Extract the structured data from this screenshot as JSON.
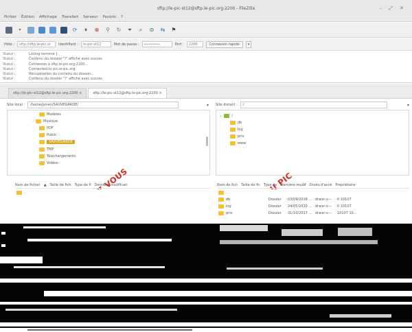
{
  "window": {
    "title": "sftp://le-pic-st12@sftp.le-pic.org:2200 - FileZilla",
    "controls": "– ⤢ ✕"
  },
  "menu": [
    "Fichier",
    "Édition",
    "Affichage",
    "Transfert",
    "Serveur",
    "Favoris",
    "?"
  ],
  "toolbar": {
    "icons": [
      "site-manager-icon",
      "dropdown-icon",
      "toggle-log-icon",
      "toggle-tree-icon",
      "toggle-remote-tree-icon",
      "toggle-queue-icon",
      "refresh-icon",
      "process-queue-icon",
      "cancel-icon",
      "disconnect-icon",
      "reconnect-icon",
      "filter-icon",
      "search-icon",
      "compare-icon",
      "sync-icon",
      "find-icon"
    ]
  },
  "quickconnect": {
    "host_label": "Hôte :",
    "host_value": "sftp://sftp.le-pic.or",
    "user_label": "Identifiant :",
    "user_value": "le-pic-st12",
    "pass_label": "Mot de passe :",
    "pass_value": "••••••••",
    "port_label": "Port :",
    "port_value": "2200",
    "connect_button": "Connexion rapide"
  },
  "log": [
    {
      "k": "Statut :",
      "v": "Listing terminé ]"
    },
    {
      "k": "Statut :",
      "v": "Contenu du dossier \"/\" affiché avec succès"
    },
    {
      "k": "Statut :",
      "v": "Connexion à sftp.le-pic.org:2200..."
    },
    {
      "k": "Statut :",
      "v": "Connected to pic.le-pic.org"
    },
    {
      "k": "Statut :",
      "v": "Récupération du contenu du dossier..."
    },
    {
      "k": "Statut :",
      "v": "Contenu du dossier \"/\" affiché avec succès"
    }
  ],
  "tabs": [
    {
      "label": "sftp://le-pic-st12@sftp.le-pic.org:2200 ×"
    },
    {
      "label": "sftp://le-pic-st12@sftp.le-pic.org:2200 ×"
    }
  ],
  "local": {
    "label": "Site local :",
    "path": "/home/pmen/SAUVEGARDE/",
    "tree": [
      "Modèles",
      "Musique",
      "PDF",
      "Public",
      "SAUVEGARDE",
      "TMP",
      "Téléchargements",
      "Vidéos"
    ],
    "selected_index": 4,
    "headers": [
      "Nom de fichier",
      "Taille de fich",
      "Type de fi",
      "Dernière modificati"
    ],
    "files": [
      ".."
    ]
  },
  "remote": {
    "label": "Site distant :",
    "path": "/",
    "tree": [
      "/",
      "db",
      "log",
      "priv",
      "www"
    ],
    "headers": [
      "Nom de fich",
      "Taille de fic",
      "Type de",
      "Dernière modif",
      "Droits d'accè",
      "Propriétaire"
    ],
    "files": [
      {
        "name": "..",
        "size": "",
        "type": "",
        "date": "",
        "perms": "",
        "owner": ""
      },
      {
        "name": "db",
        "size": "",
        "type": "Dossier",
        "date": "03/09/2018 ...",
        "perms": "drwxr-x---",
        "owner": "0 10107"
      },
      {
        "name": "log",
        "size": "",
        "type": "Dossier",
        "date": "24/05/2020 ...",
        "perms": "drwxr-x---",
        "owner": "0 10107"
      },
      {
        "name": "priv",
        "size": "",
        "type": "Dossier",
        "date": "31/10/2017 ...",
        "perms": "drwxr-x---",
        "owner": "10107 10..."
      }
    ]
  },
  "annotations": {
    "local": "CHEZ VOUS",
    "remote": "AU PIC"
  },
  "colors": {
    "folder": "#f2c230",
    "selection": "#d8a520",
    "annotation": "#d22a1b"
  }
}
